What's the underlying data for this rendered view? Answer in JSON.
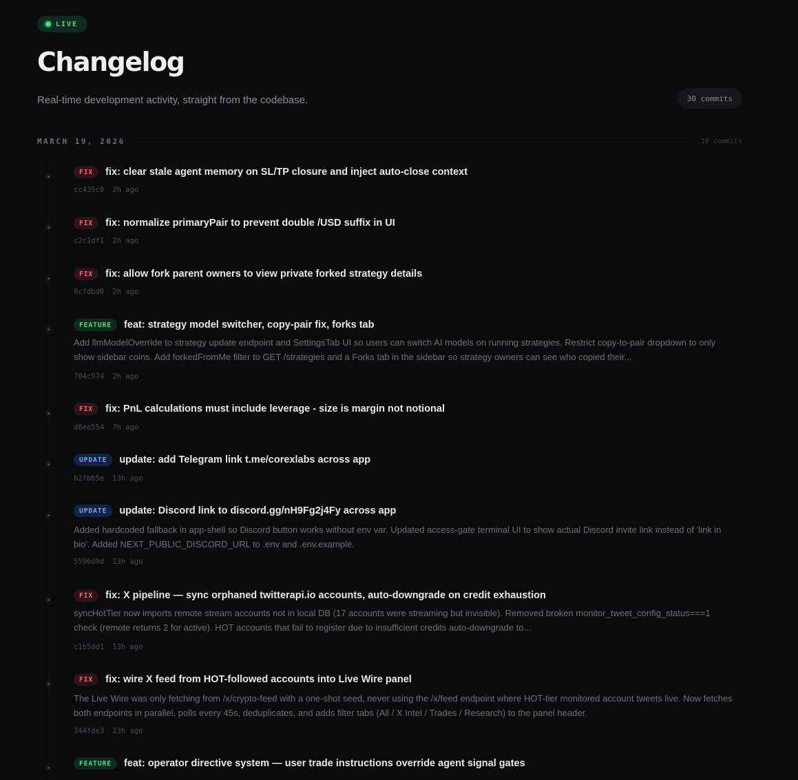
{
  "live_label": "LIVE",
  "page_title": "Changelog",
  "subtitle": "Real-time development activity, straight from the codebase.",
  "total_commits": "30 commits",
  "group": {
    "date": "MARCH 19, 2026",
    "count": "10 commits"
  },
  "commits": [
    {
      "tag": "FIX",
      "kind": "fix",
      "message": "fix: clear stale agent memory on SL/TP closure and inject auto-close context",
      "body": "",
      "hash": "cc435c0",
      "time": "2h ago"
    },
    {
      "tag": "FIX",
      "kind": "fix",
      "message": "fix: normalize primaryPair to prevent double /USD suffix in UI",
      "body": "",
      "hash": "c2c1df1",
      "time": "2h ago"
    },
    {
      "tag": "FIX",
      "kind": "fix",
      "message": "fix: allow fork parent owners to view private forked strategy details",
      "body": "",
      "hash": "8cfdbd0",
      "time": "2h ago"
    },
    {
      "tag": "FEATURE",
      "kind": "feature",
      "message": "feat: strategy model switcher, copy-pair fix, forks tab",
      "body": "Add llmModelOverride to strategy update endpoint and SettingsTab UI so users can switch AI models on running strategies. Restrict copy-to-pair dropdown to only show sidebar coins. Add forkedFromMe filter to GET /strategies and a Forks tab in the sidebar so strategy owners can see who copied their...",
      "hash": "704c974",
      "time": "2h ago"
    },
    {
      "tag": "FIX",
      "kind": "fix",
      "message": "fix: PnL calculations must include leverage - size is margin not notional",
      "body": "",
      "hash": "d8ee554",
      "time": "7h ago"
    },
    {
      "tag": "UPDATE",
      "kind": "update",
      "message": "update: add Telegram link t.me/corexlabs across app",
      "body": "",
      "hash": "b2fbb5e",
      "time": "13h ago"
    },
    {
      "tag": "UPDATE",
      "kind": "update",
      "message": "update: Discord link to discord.gg/nH9Fg2j4Fy across app",
      "body": "Added hardcoded fallback in app-shell so Discord button works without env var. Updated access-gate terminal UI to show actual Discord invite link instead of 'link in bio'. Added NEXT_PUBLIC_DISCORD_URL to .env and .env.example.",
      "hash": "5596d9d",
      "time": "13h ago"
    },
    {
      "tag": "FIX",
      "kind": "fix",
      "message": "fix: X pipeline — sync orphaned twitterapi.io accounts, auto-downgrade on credit exhaustion",
      "body": "syncHotTier now imports remote stream accounts not in local DB (17 accounts were streaming but invisible). Removed broken monitor_tweet_config_status===1 check (remote returns 2 for active). HOT accounts that fail to register due to insufficient credits auto-downgrade to...",
      "hash": "c1b5dd1",
      "time": "13h ago"
    },
    {
      "tag": "FIX",
      "kind": "fix",
      "message": "fix: wire X feed from HOT-followed accounts into Live Wire panel",
      "body": "The Live Wire was only fetching from /x/crypto-feed with a one-shot seed, never using the /x/feed endpoint where HOT-tier monitored account tweets live. Now fetches both endpoints in parallel, polls every 45s, deduplicates, and adds filter tabs (All / X Intel / Trades / Research) to the panel header.",
      "hash": "344fde3",
      "time": "13h ago"
    },
    {
      "tag": "FEATURE",
      "kind": "feature",
      "message": "feat: operator directive system — user trade instructions override agent signal gates",
      "body": "",
      "hash": "",
      "time": ""
    }
  ]
}
